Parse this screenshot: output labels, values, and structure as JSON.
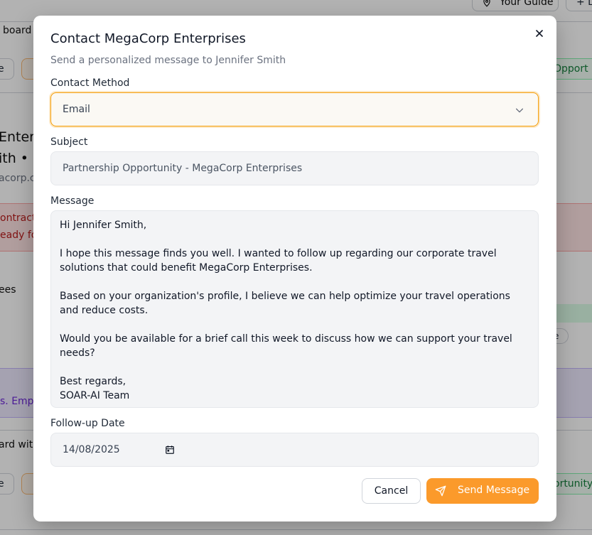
{
  "background": {
    "guide_button": "Your Guide",
    "plus_button": "+ L",
    "row1_text": "board",
    "row1_chip_left": "e",
    "row1_chip_opportunity": "Opport",
    "company_name_partial": "Enterp",
    "contact_line_partial": "ith • P",
    "email_partial": "acorp.c",
    "alert_line1": "ontract",
    "alert_line2": "eady fo",
    "employees_partial": "ees",
    "tag_partial": "e",
    "purple_text": "s. Emph",
    "row2_text": "ard with",
    "row2_chip_left": "e",
    "row2_chip_opportunity": "ortunity"
  },
  "modal": {
    "title": "Contact MegaCorp Enterprises",
    "subtitle": "Send a personalized message to Jennifer Smith",
    "contact_method_label": "Contact Method",
    "contact_method_value": "Email",
    "subject_label": "Subject",
    "subject_value": "Partnership Opportunity - MegaCorp Enterprises",
    "message_label": "Message",
    "message_lines": {
      "greeting": "Hi Jennifer Smith,",
      "p1": "I hope this message finds you well. I wanted to follow up regarding our corporate travel solutions that could benefit MegaCorp Enterprises.",
      "p2": "Based on your organization's profile, I believe we can help optimize your travel operations and reduce costs.",
      "p3": "Would you be available for a brief call this week to discuss how we can support your travel needs?",
      "signoff": "Best regards,",
      "signature": "SOAR-AI Team"
    },
    "followup_label": "Follow-up Date",
    "followup_value": "14/08/2025",
    "cancel_label": "Cancel",
    "send_label": "Send Message"
  },
  "icons": {
    "close": "close-icon",
    "chevron": "chevron-down-icon",
    "calendar": "calendar-icon",
    "send": "send-icon",
    "pin": "map-pin-icon"
  },
  "colors": {
    "accent": "#fb9a2b",
    "focus_border": "#f59e0b",
    "field_bg": "#f3f4f6"
  }
}
